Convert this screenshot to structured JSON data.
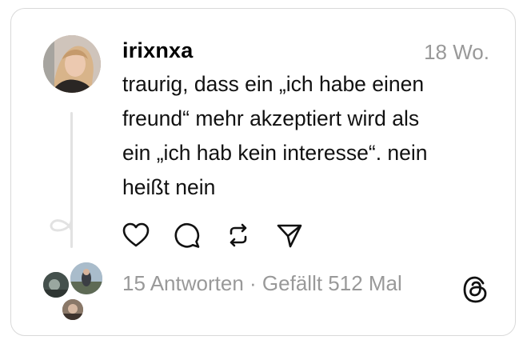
{
  "post": {
    "username": "irixnxa",
    "timestamp": "18 Wo.",
    "text_lines": [
      "traurig, dass ein „ich habe einen",
      "freund“ mehr akzeptiert wird als",
      "ein „ich hab kein interesse“. nein",
      "heißt nein"
    ]
  },
  "actions": [
    {
      "name": "like",
      "icon": "heart-icon"
    },
    {
      "name": "reply",
      "icon": "comment-icon"
    },
    {
      "name": "repost",
      "icon": "repost-icon"
    },
    {
      "name": "share",
      "icon": "send-icon"
    }
  ],
  "stats": {
    "replies": "15 Antworten",
    "separator": "·",
    "likes": "Gefällt 512 Mal"
  },
  "brand": {
    "logo_icon": "threads-logo-icon"
  },
  "colors": {
    "muted_text": "#999999",
    "border": "#d9d9d9",
    "thread_line": "#e2e2e2"
  }
}
